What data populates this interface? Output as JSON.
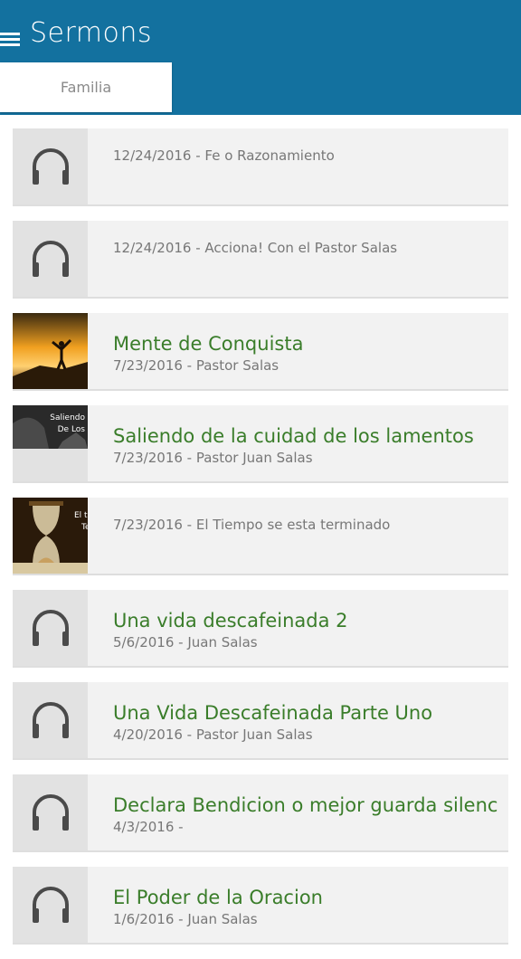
{
  "app": {
    "title": "Sermons",
    "tab_label": "Familia"
  },
  "colors": {
    "header": "#13719f",
    "title_green": "#3a7d2a",
    "subtitle_gray": "#777777",
    "item_bg": "#f2f2f2"
  },
  "items": [
    {
      "title": "",
      "subtitle": "12/24/2016 - Fe o Razonamiento",
      "thumb": "headphones-icon"
    },
    {
      "title": "",
      "subtitle": "12/24/2016 - Acciona! Con el Pastor Salas",
      "thumb": "headphones-icon"
    },
    {
      "title": "Mente de Conquista",
      "subtitle": "7/23/2016 - Pastor Salas",
      "thumb": "sunset-image"
    },
    {
      "title": "Saliendo de la cuidad de los lamentos",
      "subtitle": "7/23/2016 - Pastor Juan Salas",
      "thumb": "dark-image",
      "thumb_text": [
        "Saliendo",
        "De Los"
      ]
    },
    {
      "title": "",
      "subtitle": "7/23/2016 - El Tiempo se esta terminado",
      "thumb": "hourglass-image",
      "thumb_text": [
        "El ti",
        "Te"
      ]
    },
    {
      "title": "Una vida descafeinada 2",
      "subtitle": "5/6/2016 - Juan Salas",
      "thumb": "headphones-icon"
    },
    {
      "title": "Una Vida Descafeinada Parte Uno",
      "subtitle": "4/20/2016 - Pastor Juan Salas",
      "thumb": "headphones-icon"
    },
    {
      "title": "Declara Bendicion o mejor guarda silencio",
      "subtitle": "4/3/2016 -",
      "thumb": "headphones-icon"
    },
    {
      "title": "El Poder de la Oracion",
      "subtitle": "1/6/2016 - Juan Salas",
      "thumb": "headphones-icon"
    }
  ]
}
